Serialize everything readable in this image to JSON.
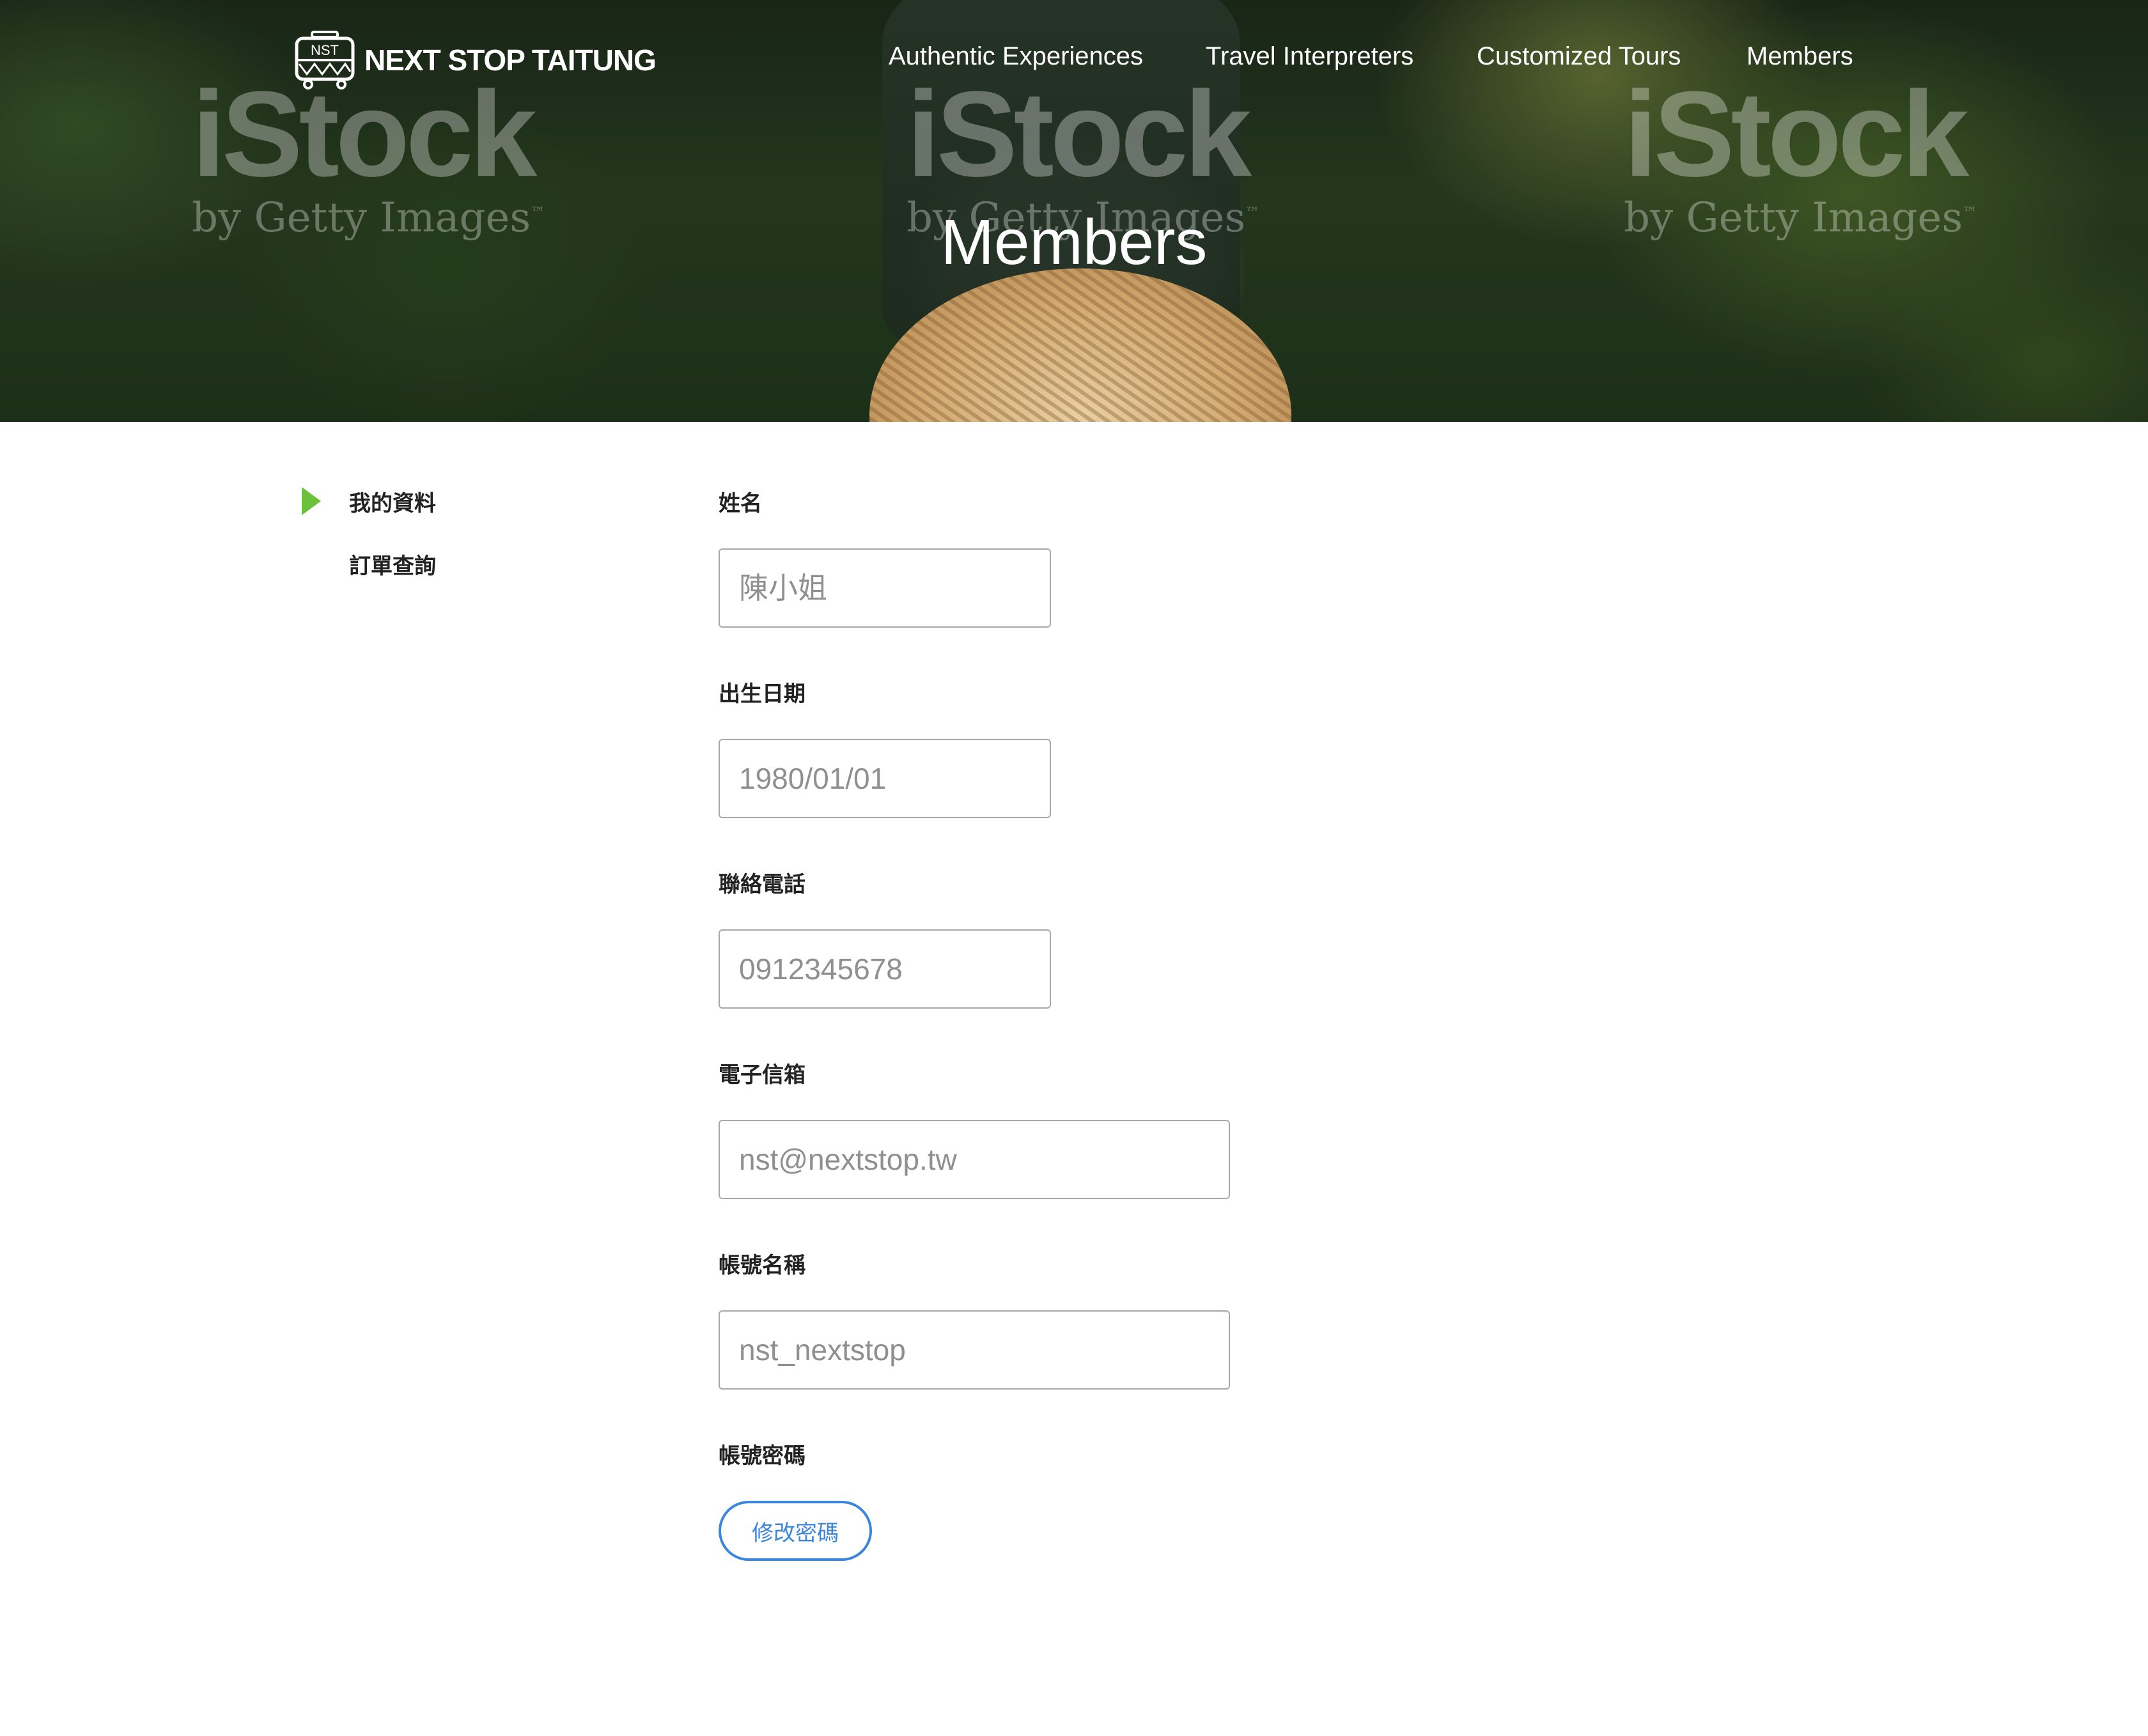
{
  "brand": {
    "logo_badge": "NST",
    "name": "NEXT STOP TAITUNG"
  },
  "nav": {
    "items": [
      "Authentic Experiences",
      "Travel Interpreters",
      "Customized Tours",
      "Members"
    ]
  },
  "hero": {
    "title": "Members",
    "watermark_main": "iStock",
    "watermark_sub": "by Getty Images",
    "watermark_tm": "™"
  },
  "sidebar": {
    "active_marker_icon": "play-triangle-icon",
    "active_marker_color": "#6cc13a",
    "items": [
      "我的資料",
      "訂單查詢"
    ]
  },
  "form": {
    "name": {
      "label": "姓名",
      "placeholder": "陳小姐"
    },
    "birthday": {
      "label": "出生日期",
      "placeholder": "1980/01/01"
    },
    "phone": {
      "label": "聯絡電話",
      "placeholder": "0912345678"
    },
    "email": {
      "label": "電子信箱",
      "placeholder": "nst@nextstop.tw"
    },
    "username": {
      "label": "帳號名稱",
      "placeholder": "nst_nextstop"
    },
    "password": {
      "label": "帳號密碼",
      "button_label": "修改密碼"
    }
  },
  "colors": {
    "accent_blue": "#3b86dc",
    "accent_green": "#6cc13a"
  }
}
